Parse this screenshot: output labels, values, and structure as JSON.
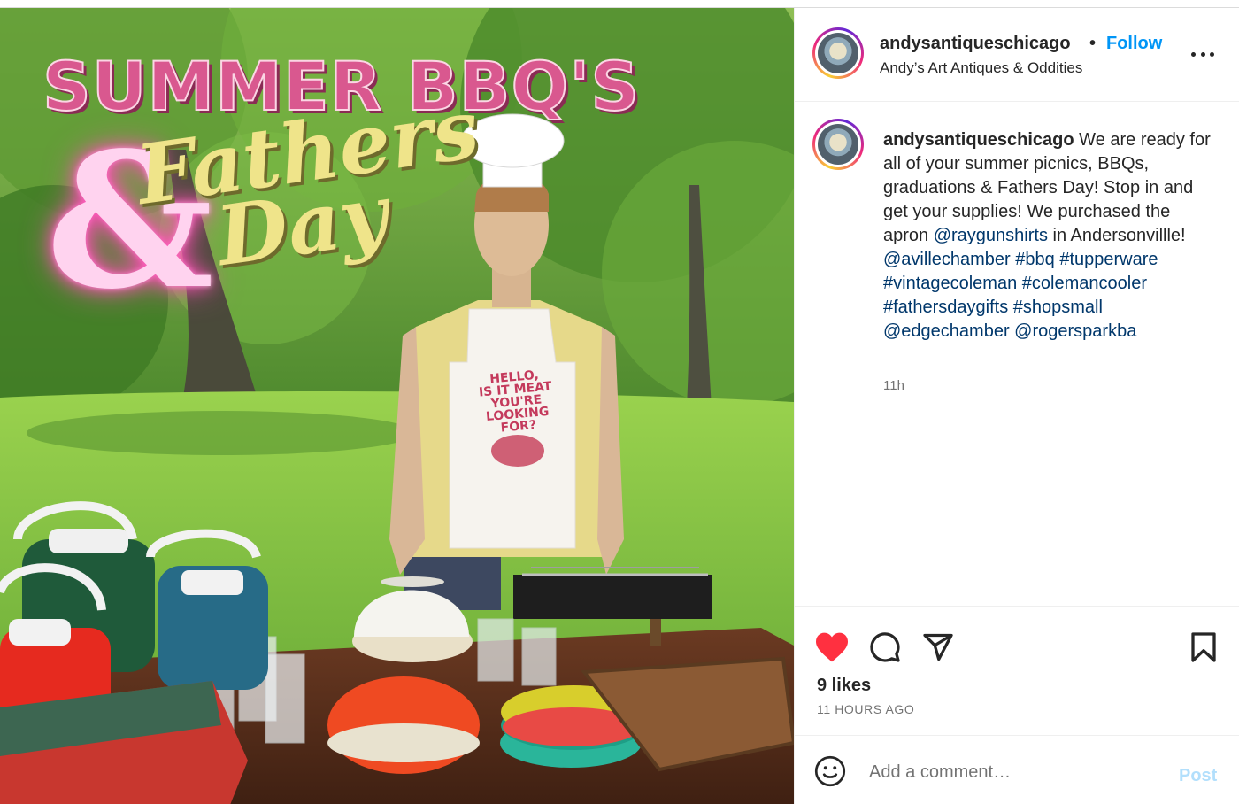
{
  "post": {
    "image": {
      "alt_semantic": "post-photo",
      "overlay_title": "SUMMER BBQ'S",
      "overlay_amp": "&",
      "overlay_script_line1": "Fathers",
      "overlay_script_line2": "Day",
      "apron_text": [
        "HELLO,",
        "IS IT MEAT",
        "YOU'RE",
        "LOOKING",
        "FOR?"
      ],
      "colors": {
        "title_pink": "#d9588f",
        "neon_pink": "#ff4fb8",
        "script_yellow": "#efe48a"
      }
    },
    "header": {
      "username": "andysantiqueschicago",
      "separator": "•",
      "follow_label": "Follow",
      "subtitle": "Andy’s Art Antiques & Oddities",
      "more_icon": "more-horizontal-icon"
    },
    "caption": {
      "username": "andysantiqueschicago",
      "text_1": " We are ready for all of your summer picnics, BBQs, graduations & Fathers Day! Stop in and get your supplies! We purchased the apron ",
      "mention_1": "@raygunshirts",
      "text_2": " in Andersonvillle! ",
      "mention_2": "@avillechamber",
      "hashtags": [
        "#bbq",
        "#tupperware",
        "#vintagecoleman",
        "#colemancooler",
        "#fathersdaygifts",
        "#shopsmall"
      ],
      "mention_3": "@edgechamber",
      "mention_4": "@rogersparkba",
      "time": "11h"
    },
    "actions": {
      "like_icon": "heart-filled-icon",
      "comment_icon": "comment-icon",
      "share_icon": "send-icon",
      "save_icon": "bookmark-icon",
      "likes": "9 likes",
      "time_ago": "11 HOURS AGO",
      "like_color": "#ff3040"
    },
    "comment_box": {
      "emoji_icon": "smiley-icon",
      "placeholder": "Add a comment…",
      "post_label": "Post",
      "post_color": "#b2dffc"
    }
  }
}
